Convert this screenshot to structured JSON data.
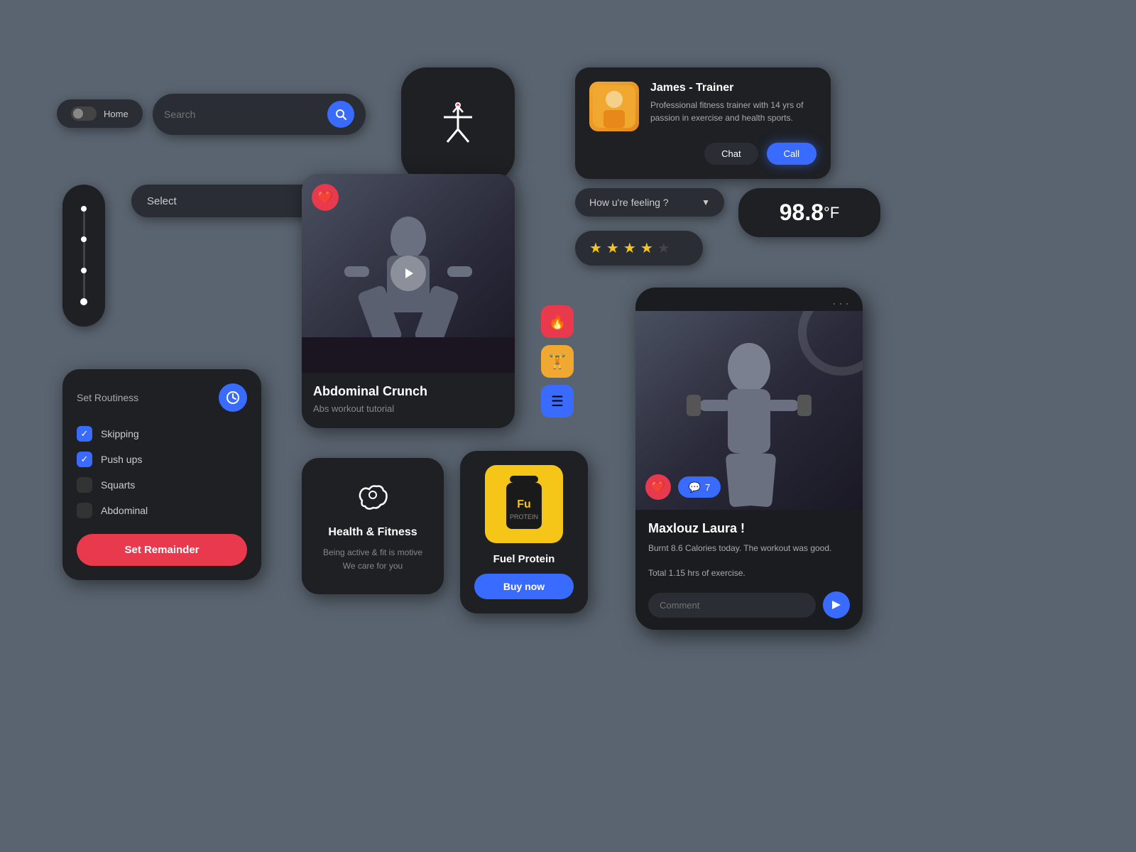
{
  "toggle": {
    "label": "Home"
  },
  "search": {
    "placeholder": "Search"
  },
  "select": {
    "label": "Select",
    "chevron": "›"
  },
  "trainer": {
    "name": "James - Trainer",
    "description": "Professional fitness trainer with 14 yrs of passion in exercise and health sports.",
    "chat_label": "Chat",
    "call_label": "Call"
  },
  "feeling": {
    "label": "How u're feeling ?",
    "chevron": "▼"
  },
  "stars": {
    "count": 4,
    "max": 5
  },
  "temperature": {
    "value": "98.8",
    "unit": "°F"
  },
  "video": {
    "title": "Abdominal Crunch",
    "subtitle": "Abs workout tutorial"
  },
  "routine": {
    "title": "Set Routiness",
    "items": [
      {
        "label": "Skipping",
        "checked": true
      },
      {
        "label": "Push ups",
        "checked": true
      },
      {
        "label": "Squarts",
        "checked": false
      },
      {
        "label": "Abdominal",
        "checked": false
      }
    ],
    "reminder_label": "Set Remainder"
  },
  "health": {
    "title": "Health & Fitness",
    "subtitle1": "Being active & fit is motive",
    "subtitle2": "We care for you"
  },
  "protein": {
    "name": "Fuel Protein",
    "buy_label": "Buy now",
    "icon": "Fu"
  },
  "profile": {
    "name": "Maxlouz Laura !",
    "desc1": "Burnt 8.6 Calories today. The workout was good.",
    "desc2": "Total 1.15 hrs of exercise.",
    "comment_placeholder": "Comment",
    "reaction_count": "7"
  },
  "action_icons": {
    "fire": "🔥",
    "dumbbell": "🏋",
    "list": "☰"
  },
  "colors": {
    "bg": "#5a6470",
    "card_dark": "#1e2024",
    "card_medium": "#2a2d33",
    "accent_blue": "#3a6bff",
    "accent_red": "#e8394d",
    "accent_yellow": "#f5c518",
    "accent_orange": "#f0a830"
  }
}
